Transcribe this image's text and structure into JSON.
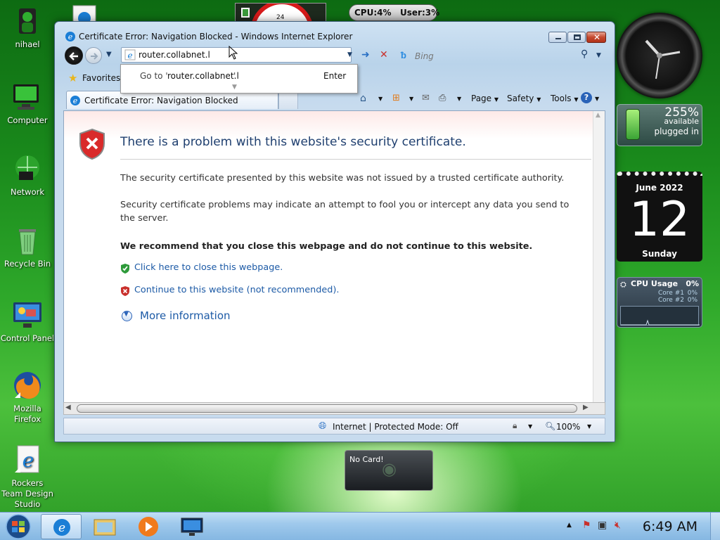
{
  "desktop": {
    "icons": [
      {
        "label": "nihael"
      },
      {
        "label": "Computer"
      },
      {
        "label": "Network"
      },
      {
        "label": "Recycle Bin"
      },
      {
        "label": "Control Panel"
      },
      {
        "label": "Mozilla Firefox"
      },
      {
        "label": "Rockers Team Design Studio"
      }
    ],
    "top_gadget_stats": {
      "cpu": "CPU:4%",
      "user": "User:3%"
    },
    "clock_number": "24"
  },
  "window": {
    "title": "Certificate Error: Navigation Blocked - Windows Internet Explorer",
    "address": "router.collabnet.l",
    "search_placeholder": "Bing",
    "dropdown": {
      "go_to": "Go to '",
      "url": "router.collabnet.l",
      "quote": "'",
      "enter": "Enter"
    },
    "favorites_label": "Favorites",
    "tab_label": "Certificate Error: Navigation Blocked",
    "commands": {
      "page": "Page",
      "safety": "Safety",
      "tools": "Tools"
    },
    "content": {
      "heading": "There is a problem with this website's security certificate.",
      "para1": "The security certificate presented by this website was not issued by a trusted certificate authority.",
      "para2": "Security certificate problems may indicate an attempt to fool you or intercept any data you send to the server.",
      "recommend": "We recommend that you close this webpage and do not continue to this website.",
      "close_link": "Click here to close this webpage.",
      "continue_link": "Continue to this website (not recommended).",
      "more_info": "More information"
    },
    "status": {
      "zone": "Internet | Protected Mode: Off",
      "zoom": "100%"
    }
  },
  "gadgets": {
    "battery": {
      "percent": "255%",
      "available": "available",
      "state": "plugged in"
    },
    "calendar": {
      "month_year": "June 2022",
      "day": "12",
      "weekday": "Sunday"
    },
    "cpu": {
      "title": "CPU Usage",
      "value": "0%",
      "core1": "Core #1",
      "core1_val": "0%",
      "core2": "Core #2",
      "core2_val": "0%"
    },
    "nocard": "No Card!"
  },
  "taskbar": {
    "time": "6:49 AM"
  }
}
